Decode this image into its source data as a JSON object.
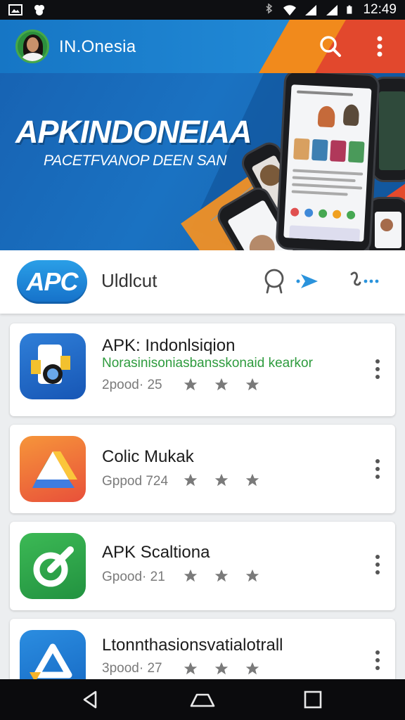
{
  "status_bar": {
    "time": "12:49",
    "icons": [
      "gallery-icon",
      "bluetooth-icon",
      "wifi-icon",
      "signal-icon",
      "signal-icon",
      "battery-icon"
    ]
  },
  "app_bar": {
    "title": "IN.Onesia",
    "actions": [
      "search-icon",
      "more-vert-icon"
    ]
  },
  "banner": {
    "title": "APKINDONEIAA",
    "subtitle": "PACETFVANOP DEEN SAN"
  },
  "search_card": {
    "logo_text": "APC",
    "label": "Uldlcut",
    "actions": [
      "search-icon",
      "send-icon",
      "share-icon"
    ]
  },
  "apps": [
    {
      "title": "APK: Indonlsiqion",
      "subtitle": "Norasinisoniasbansskonaid kearkor",
      "meta": "2pood· 25",
      "icon": "phone-camera-icon",
      "rating": 3
    },
    {
      "title": "Colic Mukak",
      "subtitle": "",
      "meta": "Gppod 724",
      "icon": "drive-triangle-icon",
      "rating": 3
    },
    {
      "title": "APK Scaltiona",
      "subtitle": "",
      "meta": "Gpood· 21",
      "icon": "pen-circle-icon",
      "rating": 3
    },
    {
      "title": "Ltonnthasionsvatialotrall",
      "subtitle": "",
      "meta": "3pood· 27",
      "icon": "triangle-arrow-icon",
      "rating": 3
    }
  ],
  "nav_bar": {
    "buttons": [
      "back-icon",
      "home-icon",
      "recents-icon"
    ]
  },
  "colors": {
    "primary_blue": "#1676c5",
    "accent_orange": "#f18a1c",
    "accent_red": "#e2482d",
    "subtitle_green": "#2e9b3e"
  }
}
